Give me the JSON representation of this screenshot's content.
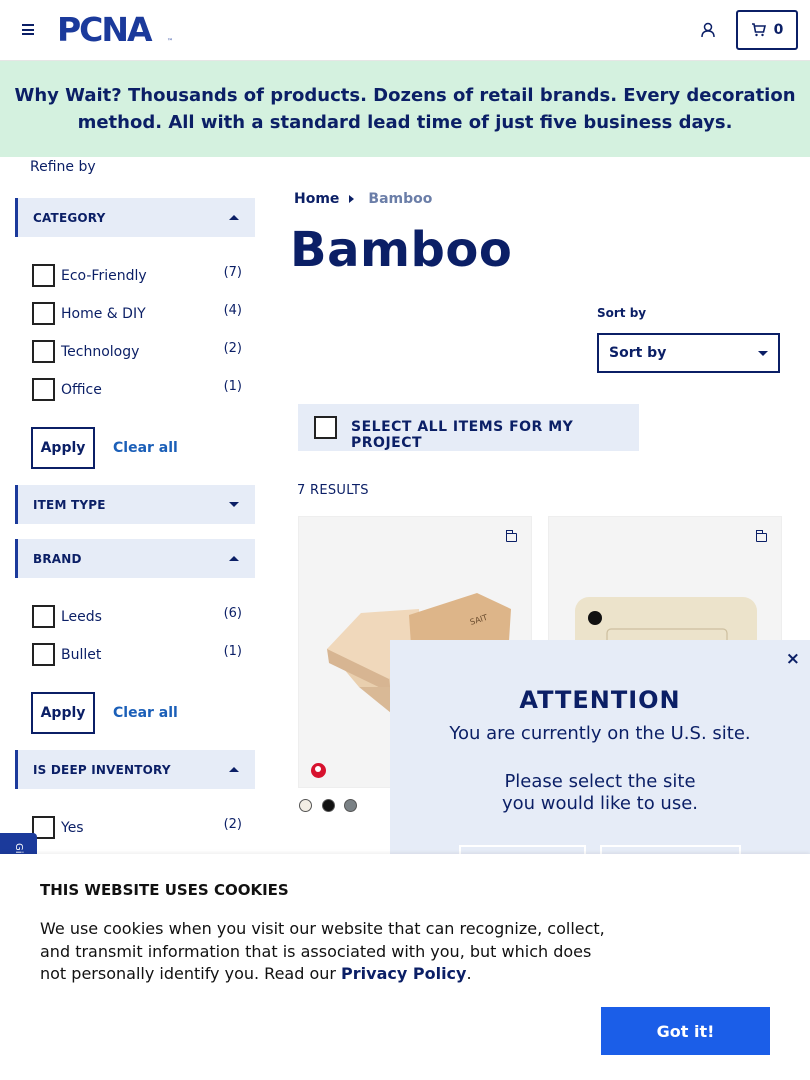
{
  "header": {
    "logo": "PCNA",
    "logo_tm": "™",
    "cart_count": "0"
  },
  "banner": {
    "text": "Why Wait? Thousands of products. Dozens of retail brands. Every decoration method. All with a standard lead time of just five business days."
  },
  "sidebar": {
    "refine_label": "Refine by",
    "category": {
      "label": "CATEGORY",
      "options": [
        {
          "label": "Eco-Friendly",
          "count": "(7)"
        },
        {
          "label": "Home & DIY",
          "count": "(4)"
        },
        {
          "label": "Technology",
          "count": "(2)"
        },
        {
          "label": "Office",
          "count": "(1)"
        }
      ]
    },
    "item_type": {
      "label": "ITEM TYPE"
    },
    "brand": {
      "label": "BRAND",
      "options": [
        {
          "label": "Leeds",
          "count": "(6)"
        },
        {
          "label": "Bullet",
          "count": "(1)"
        }
      ]
    },
    "deep_inventory": {
      "label": "IS DEEP INVENTORY",
      "options": [
        {
          "label": "Yes",
          "count": "(2)"
        }
      ]
    },
    "apply_label": "Apply",
    "clear_label": "Clear all"
  },
  "breadcrumb": {
    "home": "Home",
    "current": "Bamboo"
  },
  "page_title": "Bamboo",
  "sort": {
    "label": "Sort by",
    "value": "Sort by"
  },
  "select_all_label": "SELECT ALL ITEMS FOR MY PROJECT",
  "results_label": "7 RESULTS",
  "products": [
    {
      "swatches": [
        "#f3eee4",
        "#111111",
        "#7a8185"
      ]
    },
    {}
  ],
  "feedback_tab": "Gi",
  "modal": {
    "close": "×",
    "title": "ATTENTION",
    "subtitle": "You are currently on the U.S. site.",
    "ask": "Please select the site you would like to use."
  },
  "cookie": {
    "title": "THIS WEBSITE USES COOKIES",
    "text": "We use cookies when you visit our website that can recognize, collect, and transmit information that is associated with you, but which does not personally identify you. Read our ",
    "policy_link": "Privacy Policy",
    "text_end": ".",
    "button": "Got it!"
  },
  "colors": {
    "navy": "#0b1f66",
    "brand_blue": "#1b3a9b",
    "banner_bg": "#d4f1df",
    "panel_bg": "#e6ecf7",
    "cookie_button": "#1b5ee8"
  }
}
